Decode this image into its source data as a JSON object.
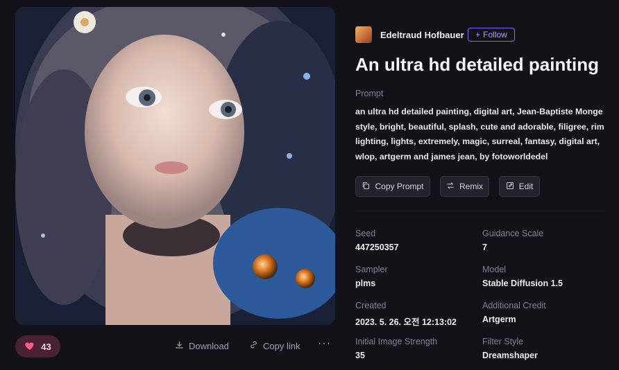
{
  "author": {
    "name": "Edeltraud Hofbauer",
    "follow_label": "Follow"
  },
  "title": "An ultra hd detailed painting",
  "prompt": {
    "label": "Prompt",
    "text": "an ultra hd detailed painting, digital art, Jean-Baptiste Monge style, bright, beautiful, splash, cute and adorable, filigree, rim lighting, lights, extremely, magic, surreal, fantasy, digital art, wlop, artgerm and james jean, by fotoworldedel"
  },
  "actions": {
    "copy_prompt": "Copy Prompt",
    "remix": "Remix",
    "edit": "Edit"
  },
  "details": {
    "seed_label": "Seed",
    "seed": "447250357",
    "guidance_label": "Guidance Scale",
    "guidance": "7",
    "sampler_label": "Sampler",
    "sampler": "plms",
    "model_label": "Model",
    "model": "Stable Diffusion 1.5",
    "created_label": "Created",
    "created": "2023. 5. 26. 오전 12:13:02",
    "credit_label": "Additional Credit",
    "credit": "Artgerm",
    "strength_label": "Initial Image Strength",
    "strength": "35",
    "filter_label": "Filter Style",
    "filter": "Dreamshaper"
  },
  "footer": {
    "likes": "43",
    "download": "Download",
    "copy_link": "Copy link",
    "more": "···"
  },
  "icons": [
    "heart-icon",
    "download-icon",
    "link-icon",
    "plus-icon",
    "copy-icon",
    "remix-icon",
    "edit-icon"
  ],
  "colors": {
    "accent": "#7b6cf0",
    "like_bg": "#4a2233",
    "heart": "#ff5c8a"
  }
}
